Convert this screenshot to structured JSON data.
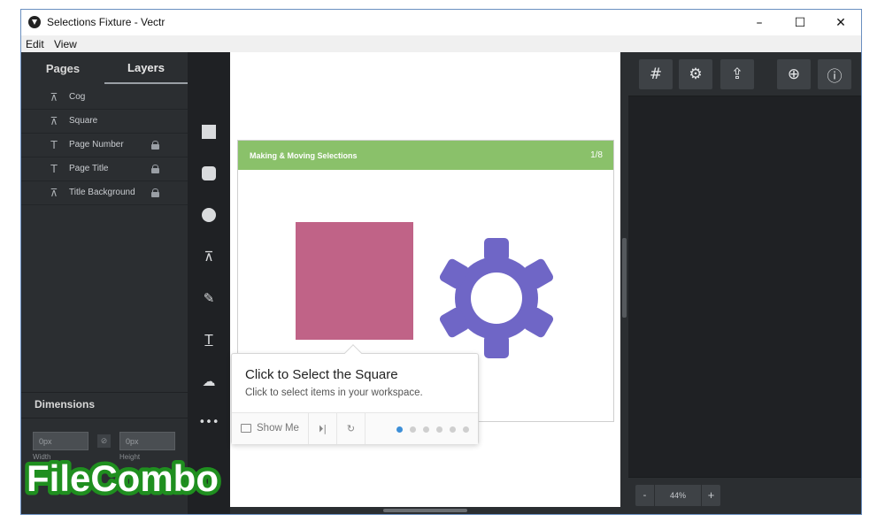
{
  "window": {
    "title": "Selections Fixture - Vectr",
    "controls": {
      "minimize": "–",
      "maximize": "☐",
      "close": "✕"
    }
  },
  "menu": {
    "items": [
      "Edit",
      "View"
    ]
  },
  "left_panel": {
    "tabs": [
      {
        "label": "Pages",
        "active": false
      },
      {
        "label": "Layers",
        "active": true
      }
    ],
    "layers": [
      {
        "name": "Cog",
        "icon": "path-icon",
        "locked": false
      },
      {
        "name": "Square",
        "icon": "path-icon",
        "locked": false
      },
      {
        "name": "Page Number",
        "icon": "text-icon",
        "locked": true
      },
      {
        "name": "Page Title",
        "icon": "text-icon",
        "locked": true
      },
      {
        "name": "Title Background",
        "icon": "path-icon",
        "locked": true
      }
    ],
    "dimensions": {
      "title": "Dimensions",
      "width_value": "0px",
      "height_value": "0px",
      "width_label": "Width",
      "height_label": "Height"
    }
  },
  "tools": [
    {
      "name": "rectangle-tool",
      "icon": "square-icon"
    },
    {
      "name": "rounded-rectangle-tool",
      "icon": "rounded-square-icon"
    },
    {
      "name": "ellipse-tool",
      "icon": "circle-icon"
    },
    {
      "name": "pen-tool",
      "icon": "pen-icon"
    },
    {
      "name": "pencil-tool",
      "icon": "pencil-icon"
    },
    {
      "name": "text-tool",
      "icon": "text-icon"
    },
    {
      "name": "upload-tool",
      "icon": "cloud-upload-icon"
    },
    {
      "name": "more-tools",
      "icon": "more-icon"
    }
  ],
  "artboard": {
    "banner_title": "Making & Moving Selections",
    "banner_number": "1/8",
    "banner_color": "#8ac16a",
    "square_color": "#c06387",
    "gear_color": "#6f66c6"
  },
  "tooltip": {
    "title": "Click to Select the Square",
    "body": "Click to select items in your workspace.",
    "show_me": "Show Me",
    "step_current": 1,
    "step_total": 6
  },
  "right_panel": {
    "buttons": [
      "grid-icon",
      "page-settings-icon",
      "export-icon",
      "new-page-icon",
      "info-icon"
    ],
    "zoom": {
      "minus": "-",
      "value": "44%",
      "plus": "+"
    }
  },
  "watermark": "FileCombo",
  "colors": {
    "panel_dark": "#2b2e31",
    "toolbar": "#1f2124",
    "accent_blue": "#3d8fd8"
  }
}
